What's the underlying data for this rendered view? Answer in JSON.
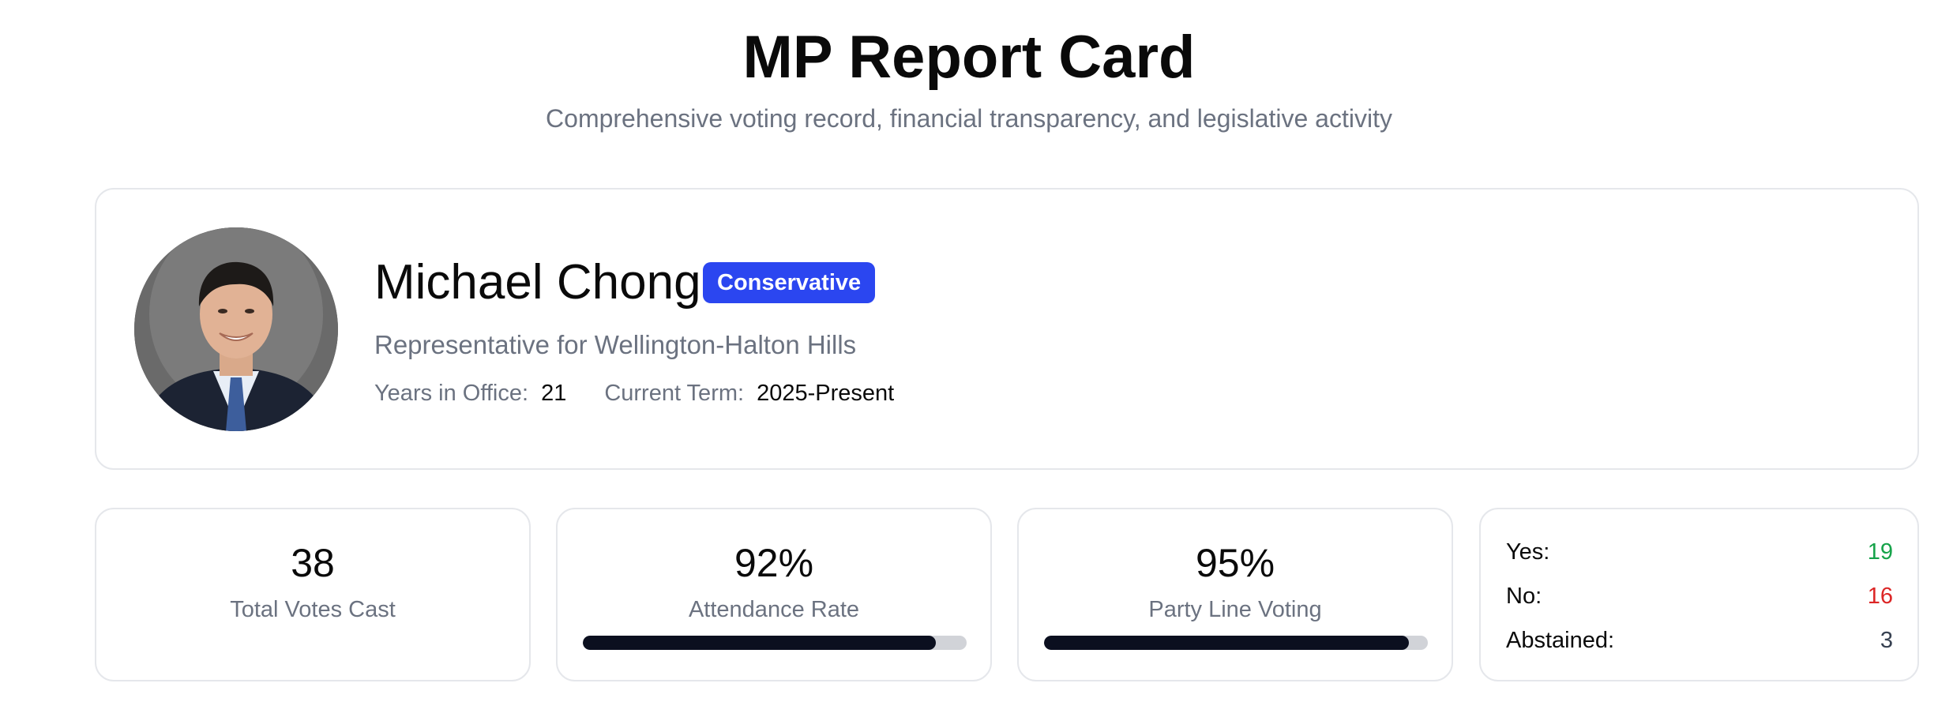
{
  "header": {
    "title": "MP Report Card",
    "subtitle": "Comprehensive voting record, financial transparency, and legislative activity"
  },
  "profile": {
    "name": "Michael Chong",
    "party": "Conservative",
    "riding": "Representative for Wellington-Halton Hills",
    "years_label": "Years in Office:",
    "years_value": "21",
    "term_label": "Current Term:",
    "term_value": "2025-Present",
    "party_color": "#2b46f0"
  },
  "stats": {
    "total_votes": {
      "value": "38",
      "label": "Total Votes Cast"
    },
    "attendance": {
      "value": "92%",
      "label": "Attendance Rate",
      "fill": 0.92
    },
    "party_line": {
      "value": "95%",
      "label": "Party Line Voting",
      "fill": 0.95
    }
  },
  "breakdown": {
    "yes_label": "Yes:",
    "yes_value": "19",
    "no_label": "No:",
    "no_value": "16",
    "abstained_label": "Abstained:",
    "abstained_value": "3",
    "yes_color": "#16a34a",
    "no_color": "#dc2626"
  }
}
